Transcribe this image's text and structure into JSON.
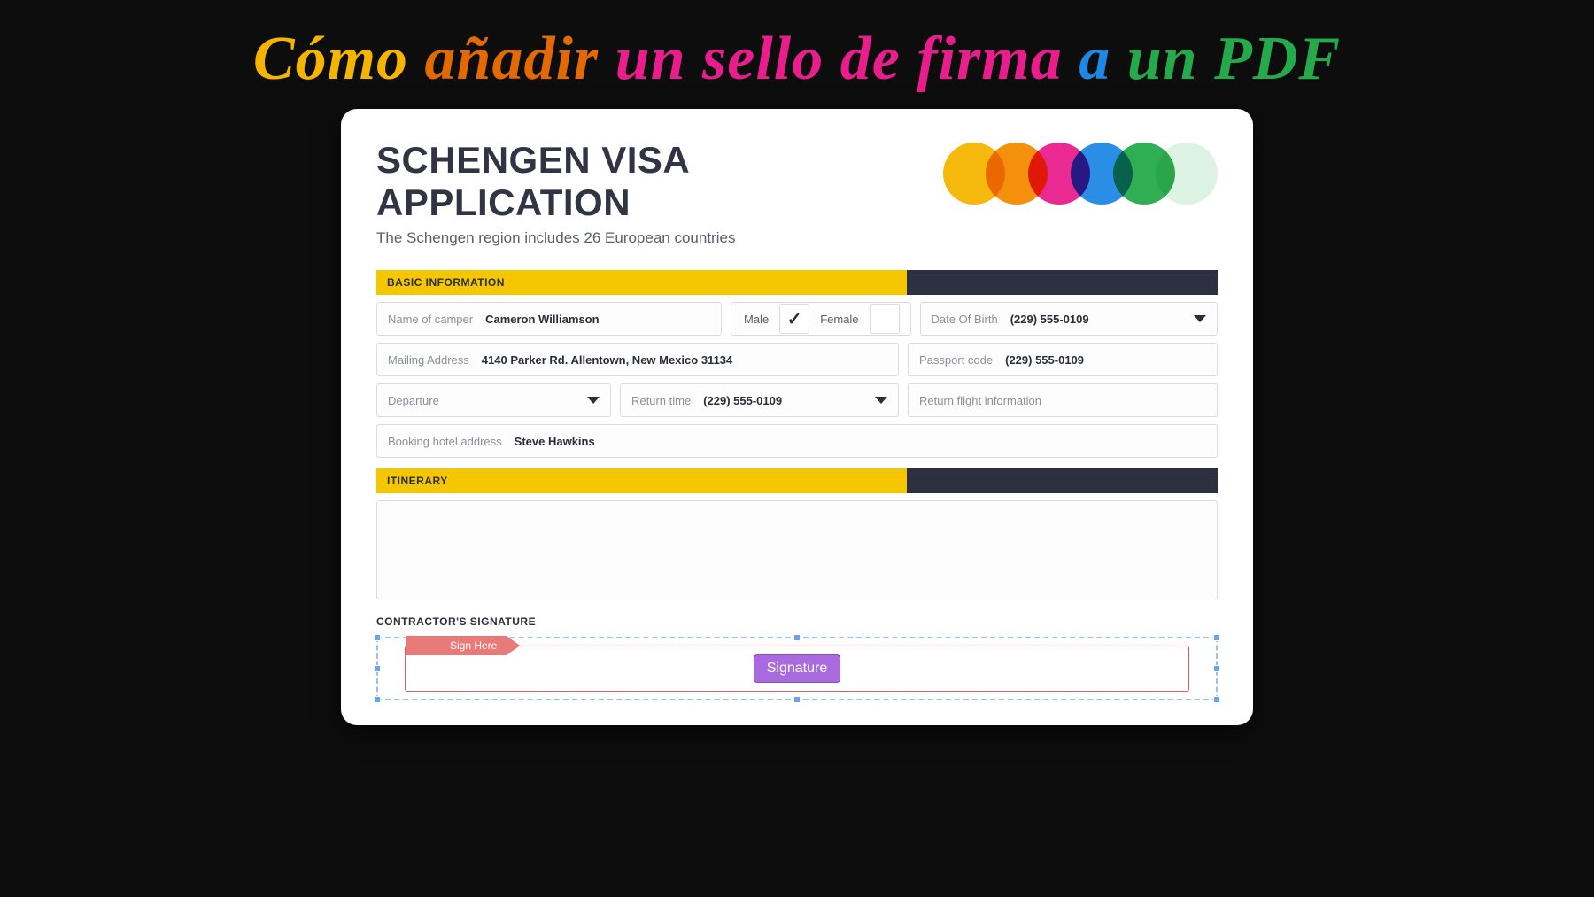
{
  "headline": {
    "w1": "Cómo",
    "w2": "añadir",
    "w3": "un sello de firma",
    "w4": "a",
    "w5": "un PDF"
  },
  "doc": {
    "title": "SCHENGEN VISA APPLICATION",
    "subtitle": "The Schengen region includes 26 European countries"
  },
  "sections": {
    "basic": "BASIC INFORMATION",
    "itinerary": "ITINERARY",
    "signature": "CONTRACTOR'S SIGNATURE"
  },
  "fields": {
    "name_label": "Name of camper",
    "name_value": "Cameron Williamson",
    "male_label": "Male",
    "female_label": "Female",
    "male_checked": "✓",
    "dob_label": "Date Of Birth",
    "dob_value": "(229) 555-0109",
    "mailing_label": "Mailing Address",
    "mailing_value": "4140 Parker Rd. Allentown, New Mexico 31134",
    "passport_label": "Passport code",
    "passport_value": "(229) 555-0109",
    "departure_label": "Departure",
    "return_label": "Return time",
    "return_value": "(229) 555-0109",
    "flight_label": "Return flight information",
    "hotel_label": "Booking hotel address",
    "hotel_value": "Steve Hawkins"
  },
  "signature": {
    "sign_here": "Sign Here",
    "button": "Signature"
  }
}
